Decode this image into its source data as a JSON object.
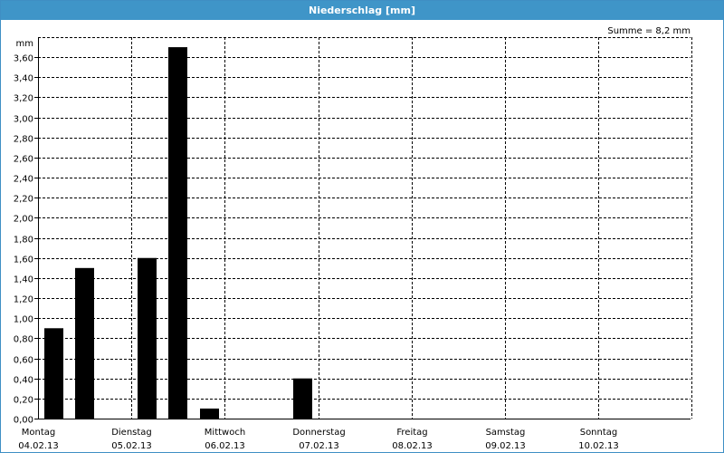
{
  "window": {
    "title": "Niederschlag [mm]"
  },
  "summary": "Summe = 8,2 mm",
  "chart_data": {
    "type": "bar",
    "title": "Niederschlag [mm]",
    "ylabel": "mm",
    "ylim": [
      0,
      3.8
    ],
    "grid": true,
    "y_ticks": [
      "0,00",
      "0,20",
      "0,40",
      "0,60",
      "0,80",
      "1,00",
      "1,20",
      "1,40",
      "1,60",
      "1,80",
      "2,00",
      "2,20",
      "2,40",
      "2,60",
      "2,80",
      "3,00",
      "3,20",
      "3,40",
      "3,60"
    ],
    "days": [
      {
        "name": "Montag",
        "date": "04.02.13"
      },
      {
        "name": "Dienstag",
        "date": "05.02.13"
      },
      {
        "name": "Mittwoch",
        "date": "06.02.13"
      },
      {
        "name": "Donnerstag",
        "date": "07.02.13"
      },
      {
        "name": "Freitag",
        "date": "08.02.13"
      },
      {
        "name": "Samstag",
        "date": "09.02.13"
      },
      {
        "name": "Sonntag",
        "date": "10.02.13"
      }
    ],
    "bar_slots_per_day": 3,
    "bars": [
      {
        "day": 0,
        "slot": 0,
        "value": 0.9
      },
      {
        "day": 0,
        "slot": 1,
        "value": 1.5
      },
      {
        "day": 1,
        "slot": 0,
        "value": 1.6
      },
      {
        "day": 1,
        "slot": 1,
        "value": 3.7
      },
      {
        "day": 1,
        "slot": 2,
        "value": 0.1
      },
      {
        "day": 2,
        "slot": 2,
        "value": 0.4
      }
    ],
    "bar_color": "#000000",
    "grid_color": "#000000"
  }
}
